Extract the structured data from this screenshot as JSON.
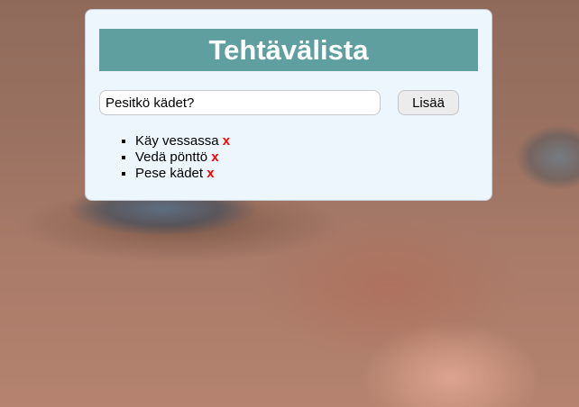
{
  "app": {
    "title": "Tehtävälista"
  },
  "form": {
    "input_value": "Pesitkö kädet?",
    "add_label": "Lisää"
  },
  "todos": [
    {
      "text": "Käy vessassa",
      "delete_label": "x"
    },
    {
      "text": "Vedä pönttö",
      "delete_label": "x"
    },
    {
      "text": "Pese kädet",
      "delete_label": "x"
    }
  ],
  "colors": {
    "title_bar": "#5f9fa0",
    "panel": "#eef6fd",
    "delete": "#ff0000"
  }
}
